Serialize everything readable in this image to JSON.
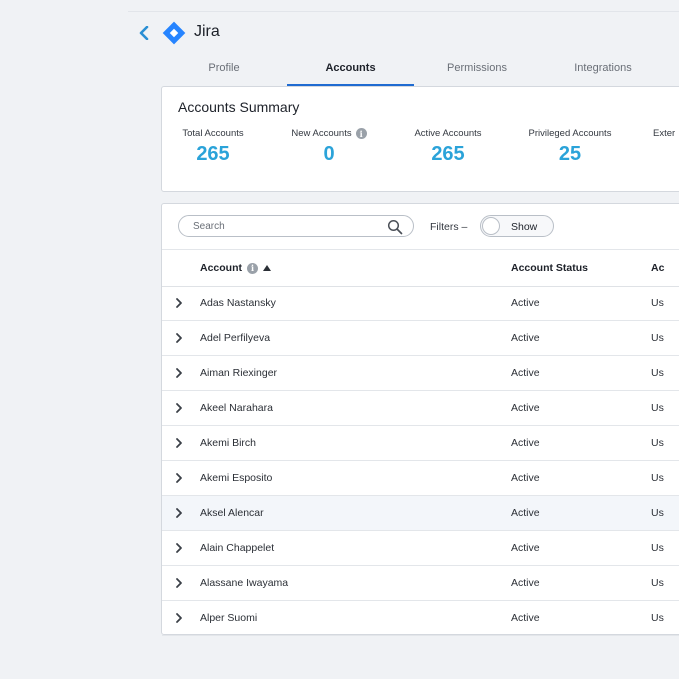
{
  "header": {
    "title": "Jira",
    "back_icon": "chevron-left-icon",
    "logo_icon": "jira-diamond-icon",
    "accent": "#2a8fd4"
  },
  "tabs": [
    {
      "label": "Profile",
      "active": false
    },
    {
      "label": "Accounts",
      "active": true
    },
    {
      "label": "Permissions",
      "active": false
    },
    {
      "label": "Integrations",
      "active": false
    }
  ],
  "summary": {
    "title": "Accounts Summary",
    "stats": [
      {
        "label": "Total Accounts",
        "value": "265"
      },
      {
        "label": "New Accounts",
        "value": "0",
        "info": true
      },
      {
        "label": "Active Accounts",
        "value": "265"
      },
      {
        "label": "Privileged Accounts",
        "value": "25"
      },
      {
        "label": "Exter"
      }
    ],
    "value_color": "#2ba3d9"
  },
  "toolbar": {
    "search_placeholder": "Search",
    "filters_label": "Filters –",
    "toggle_label": "Show"
  },
  "table": {
    "columns": [
      {
        "label": "Account",
        "info": true,
        "sort": "asc"
      },
      {
        "label": "Account Status"
      },
      {
        "label": "Ac"
      }
    ],
    "rows": [
      {
        "name": "Adas Nastansky",
        "status": "Active",
        "type": "Us"
      },
      {
        "name": "Adel Perfilyeva",
        "status": "Active",
        "type": "Us"
      },
      {
        "name": "Aiman Riexinger",
        "status": "Active",
        "type": "Us"
      },
      {
        "name": "Akeel Narahara",
        "status": "Active",
        "type": "Us"
      },
      {
        "name": "Akemi Birch",
        "status": "Active",
        "type": "Us"
      },
      {
        "name": "Akemi Esposito",
        "status": "Active",
        "type": "Us"
      },
      {
        "name": "Aksel Alencar",
        "status": "Active",
        "type": "Us",
        "highlighted": true
      },
      {
        "name": "Alain Chappelet",
        "status": "Active",
        "type": "Us"
      },
      {
        "name": "Alassane Iwayama",
        "status": "Active",
        "type": "Us"
      },
      {
        "name": "Alper Suomi",
        "status": "Active",
        "type": "Us"
      }
    ]
  }
}
